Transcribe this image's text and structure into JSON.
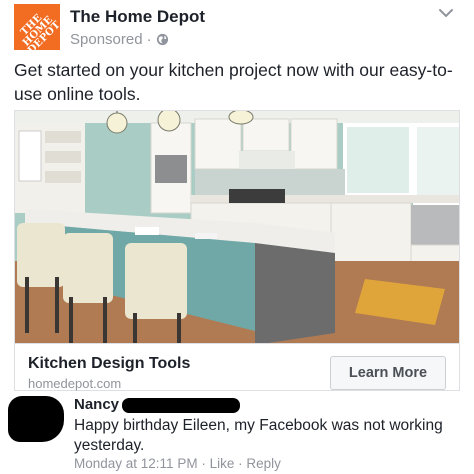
{
  "post": {
    "page_name": "The Home Depot",
    "logo_text": [
      "THE",
      "HOME",
      "DEPOT"
    ],
    "sponsored": "Sponsored",
    "separator": "·",
    "text": "Get started on your kitchen project now with our easy-to-use online tools.",
    "brand_color": "#f26c22"
  },
  "ad": {
    "title": "Kitchen Design Tools",
    "domain": "homedepot.com",
    "cta_label": "Learn More"
  },
  "comment": {
    "author": "Nancy",
    "text": "Happy birthday Eileen, my Facebook was not working yesterday.",
    "time": "Monday at 12:11 PM",
    "like": "Like",
    "reply": "Reply",
    "dot": "·"
  },
  "icons": [
    "globe-icon",
    "caret-down-icon"
  ]
}
